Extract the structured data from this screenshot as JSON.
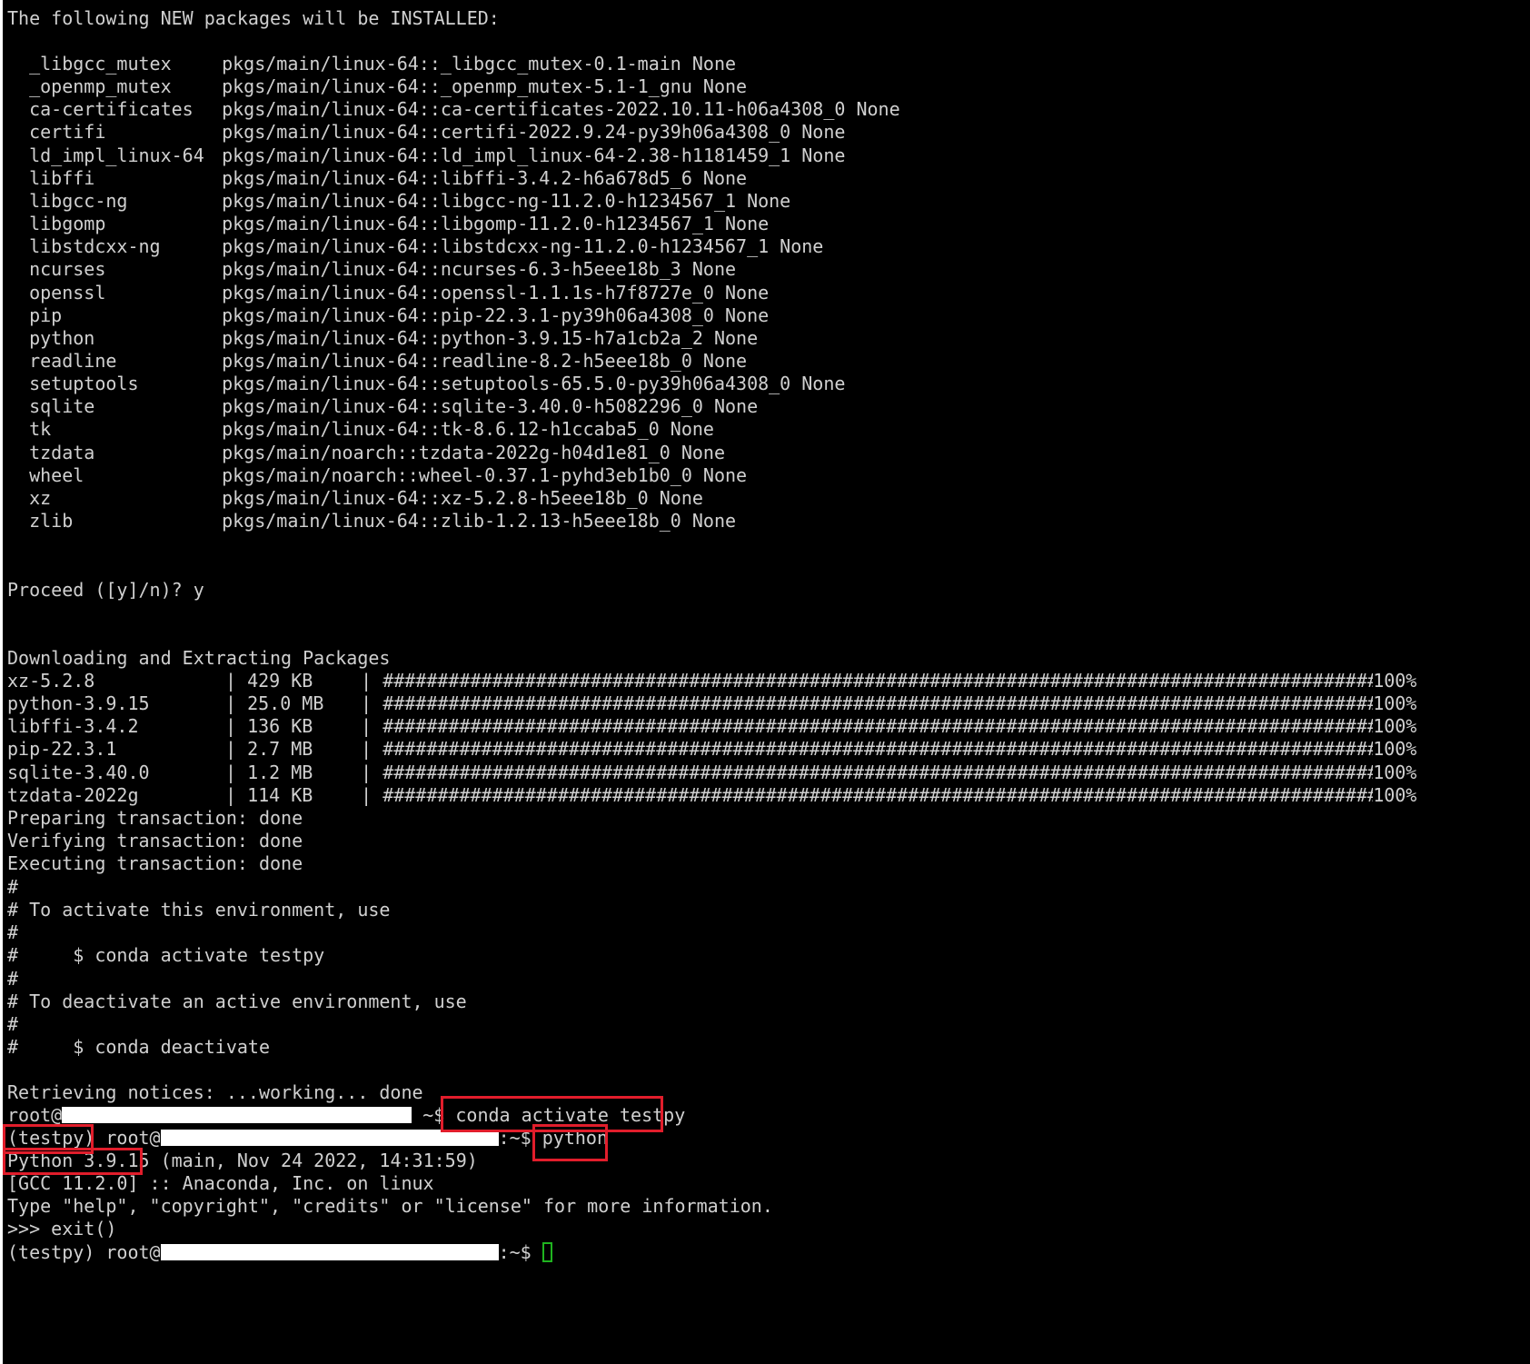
{
  "header": "The following NEW packages will be INSTALLED:",
  "packages": [
    {
      "name": "_libgcc_mutex",
      "spec": "pkgs/main/linux-64::_libgcc_mutex-0.1-main None"
    },
    {
      "name": "_openmp_mutex",
      "spec": "pkgs/main/linux-64::_openmp_mutex-5.1-1_gnu None"
    },
    {
      "name": "ca-certificates",
      "spec": "pkgs/main/linux-64::ca-certificates-2022.10.11-h06a4308_0 None"
    },
    {
      "name": "certifi",
      "spec": "pkgs/main/linux-64::certifi-2022.9.24-py39h06a4308_0 None"
    },
    {
      "name": "ld_impl_linux-64",
      "spec": "pkgs/main/linux-64::ld_impl_linux-64-2.38-h1181459_1 None"
    },
    {
      "name": "libffi",
      "spec": "pkgs/main/linux-64::libffi-3.4.2-h6a678d5_6 None"
    },
    {
      "name": "libgcc-ng",
      "spec": "pkgs/main/linux-64::libgcc-ng-11.2.0-h1234567_1 None"
    },
    {
      "name": "libgomp",
      "spec": "pkgs/main/linux-64::libgomp-11.2.0-h1234567_1 None"
    },
    {
      "name": "libstdcxx-ng",
      "spec": "pkgs/main/linux-64::libstdcxx-ng-11.2.0-h1234567_1 None"
    },
    {
      "name": "ncurses",
      "spec": "pkgs/main/linux-64::ncurses-6.3-h5eee18b_3 None"
    },
    {
      "name": "openssl",
      "spec": "pkgs/main/linux-64::openssl-1.1.1s-h7f8727e_0 None"
    },
    {
      "name": "pip",
      "spec": "pkgs/main/linux-64::pip-22.3.1-py39h06a4308_0 None"
    },
    {
      "name": "python",
      "spec": "pkgs/main/linux-64::python-3.9.15-h7a1cb2a_2 None"
    },
    {
      "name": "readline",
      "spec": "pkgs/main/linux-64::readline-8.2-h5eee18b_0 None"
    },
    {
      "name": "setuptools",
      "spec": "pkgs/main/linux-64::setuptools-65.5.0-py39h06a4308_0 None"
    },
    {
      "name": "sqlite",
      "spec": "pkgs/main/linux-64::sqlite-3.40.0-h5082296_0 None"
    },
    {
      "name": "tk",
      "spec": "pkgs/main/linux-64::tk-8.6.12-h1ccaba5_0 None"
    },
    {
      "name": "tzdata",
      "spec": "pkgs/main/noarch::tzdata-2022g-h04d1e81_0 None"
    },
    {
      "name": "wheel",
      "spec": "pkgs/main/noarch::wheel-0.37.1-pyhd3eb1b0_0 None"
    },
    {
      "name": "xz",
      "spec": "pkgs/main/linux-64::xz-5.2.8-h5eee18b_0 None"
    },
    {
      "name": "zlib",
      "spec": "pkgs/main/linux-64::zlib-1.2.13-h5eee18b_0 None"
    }
  ],
  "proceed": "Proceed ([y]/n)? y",
  "downloading_header": "Downloading and Extracting Packages",
  "downloads": [
    {
      "name": "xz-5.2.8",
      "size": "429 KB",
      "pct": "100%"
    },
    {
      "name": "python-3.9.15",
      "size": "25.0 MB",
      "pct": "100%"
    },
    {
      "name": "libffi-3.4.2",
      "size": "136 KB",
      "pct": "100%"
    },
    {
      "name": "pip-22.3.1",
      "size": "2.7 MB",
      "pct": "100%"
    },
    {
      "name": "sqlite-3.40.0",
      "size": "1.2 MB",
      "pct": "100%"
    },
    {
      "name": "tzdata-2022g",
      "size": "114 KB",
      "pct": "100%"
    }
  ],
  "progress_fill": 1.0,
  "transaction": [
    "Preparing transaction: done",
    "Verifying transaction: done",
    "Executing transaction: done"
  ],
  "activate_notes": [
    "#",
    "# To activate this environment, use",
    "#",
    "#     $ conda activate testpy",
    "#",
    "# To deactivate an active environment, use",
    "#",
    "#     $ conda deactivate"
  ],
  "notices": "Retrieving notices: ...working... done",
  "prompt_user": "root@",
  "prompt_suffix": ":~$ ",
  "prompt_suffix_first": " ~$ ",
  "cmd_activate": "conda activate testpy",
  "env_tag": "(testpy)",
  "cmd_python": "python",
  "python_version": "Python 3.9.15",
  "python_build": " (main, Nov 24 2022, 14:31:59)",
  "gcc_line": "[GCC 11.2.0] :: Anaconda, Inc. on linux",
  "help_line": "Type \"help\", \"copyright\", \"credits\" or \"license\" for more information.",
  "exit_line": ">>> exit()",
  "colors": {
    "background": "#000000",
    "text": "#d0d0d0",
    "highlight": "#e11d2b",
    "cursor": "#1fb31f"
  }
}
